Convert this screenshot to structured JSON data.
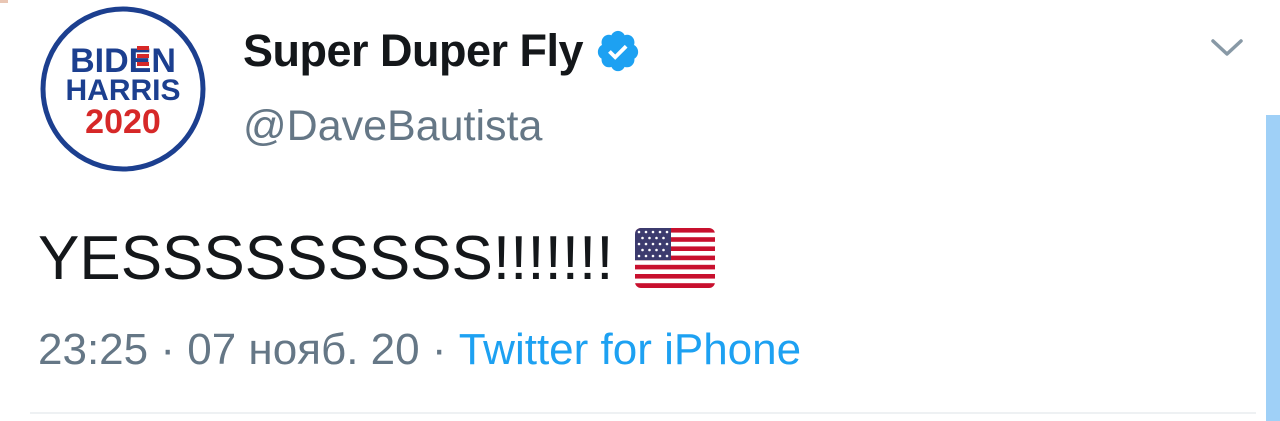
{
  "tweet": {
    "display_name": "Super Duper Fly",
    "handle": "@DaveBautista",
    "text": "YESSSSSSSSS!!!!!!!",
    "emoji": "us-flag",
    "time": "23:25",
    "separator": "·",
    "date": "07 нояб. 20",
    "source": "Twitter for iPhone"
  },
  "avatar": {
    "logo_text": [
      "BIDEN",
      "HARRIS",
      "2020"
    ],
    "colors": {
      "ring": "#1c3f8f",
      "red": "#d62828",
      "blue": "#1c3f8f"
    }
  },
  "icons": {
    "verified": "verified-badge-icon",
    "more": "chevron-down-icon",
    "emoji": "us-flag-icon"
  },
  "colors": {
    "accent": "#1da1f2",
    "text": "#14171a",
    "muted": "#657786"
  }
}
